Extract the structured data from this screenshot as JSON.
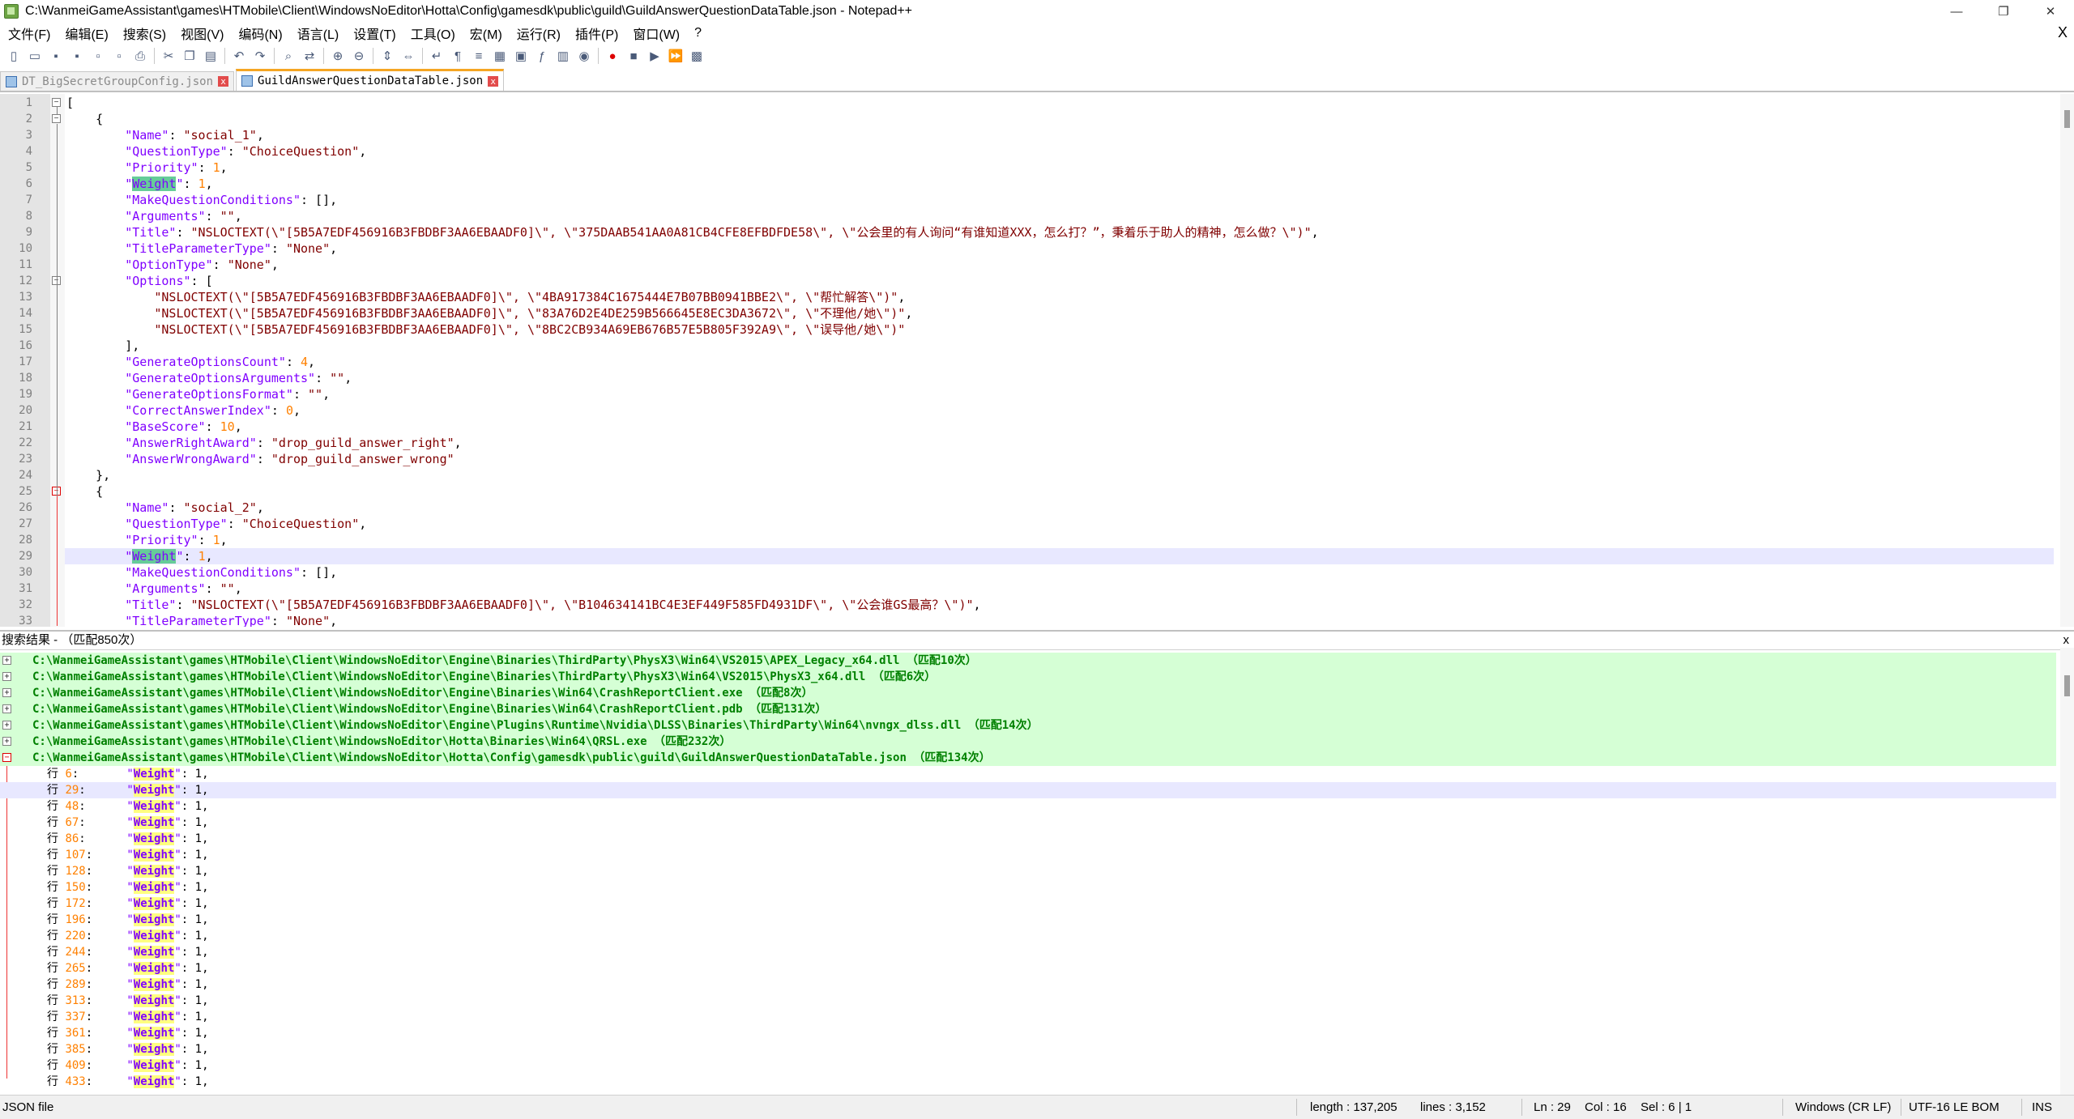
{
  "window": {
    "title": "C:\\WanmeiGameAssistant\\games\\HTMobile\\Client\\WindowsNoEditor\\Hotta\\Config\\gamesdk\\public\\guild\\GuildAnswerQuestionDataTable.json - Notepad++",
    "minimize": "—",
    "restore": "❐",
    "close": "✕"
  },
  "menu": [
    "文件(F)",
    "编辑(E)",
    "搜索(S)",
    "视图(V)",
    "编码(N)",
    "语言(L)",
    "设置(T)",
    "工具(O)",
    "宏(M)",
    "运行(R)",
    "插件(P)",
    "窗口(W)",
    "?"
  ],
  "menu_close": "X",
  "toolbar_icons": [
    "new-file-icon",
    "open-file-icon",
    "save-icon",
    "save-all-icon",
    "close-icon",
    "close-all-icon",
    "print-icon",
    "cut-icon",
    "copy-icon",
    "paste-icon",
    "undo-icon",
    "redo-icon",
    "find-icon",
    "replace-icon",
    "zoom-in-icon",
    "zoom-out-icon",
    "sync-vertical-icon",
    "sync-horizontal-icon",
    "word-wrap-icon",
    "show-all-chars-icon",
    "indent-guide-icon",
    "user-lang-icon",
    "doc-map-icon",
    "function-list-icon",
    "folder-workspace-icon",
    "monitor-icon",
    "record-macro-icon",
    "stop-record-icon",
    "play-macro-icon",
    "run-macro-multiple-icon",
    "save-macro-icon"
  ],
  "tabs": [
    {
      "label": "DT_BigSecretGroupConfig.json",
      "active": false
    },
    {
      "label": "GuildAnswerQuestionDataTable.json",
      "active": true
    }
  ],
  "editor": {
    "lines": [
      {
        "n": "1",
        "text": "["
      },
      {
        "n": "2",
        "text": "    {"
      },
      {
        "n": "3",
        "text": "        \"Name\": \"social_1\","
      },
      {
        "n": "4",
        "text": "        \"QuestionType\": \"ChoiceQuestion\","
      },
      {
        "n": "5",
        "text": "        \"Priority\": 1,"
      },
      {
        "n": "6",
        "text": "        \"Weight\": 1,"
      },
      {
        "n": "7",
        "text": "        \"MakeQuestionConditions\": [],"
      },
      {
        "n": "8",
        "text": "        \"Arguments\": \"\","
      },
      {
        "n": "9",
        "text": "        \"Title\": \"NSLOCTEXT(\\\"[5B5A7EDF456916B3FBDBF3AA6EBAADF0]\\\", \\\"375DAAB541AA0A81CB4CFE8EFBDFDE58\\\", \\\"公会里的有人询问“有谁知道XXX，怎么打？”，秉着乐于助人的精神，怎么做？\\\")\","
      },
      {
        "n": "10",
        "text": "        \"TitleParameterType\": \"None\","
      },
      {
        "n": "11",
        "text": "        \"OptionType\": \"None\","
      },
      {
        "n": "12",
        "text": "        \"Options\": ["
      },
      {
        "n": "13",
        "text": "            \"NSLOCTEXT(\\\"[5B5A7EDF456916B3FBDBF3AA6EBAADF0]\\\", \\\"4BA917384C1675444E7B07BB0941BBE2\\\", \\\"帮忙解答\\\")\","
      },
      {
        "n": "14",
        "text": "            \"NSLOCTEXT(\\\"[5B5A7EDF456916B3FBDBF3AA6EBAADF0]\\\", \\\"83A76D2E4DE259B566645E8EC3DA3672\\\", \\\"不理他/她\\\")\","
      },
      {
        "n": "15",
        "text": "            \"NSLOCTEXT(\\\"[5B5A7EDF456916B3FBDBF3AA6EBAADF0]\\\", \\\"8BC2CB934A69EB676B57E5B805F392A9\\\", \\\"误导他/她\\\")\""
      },
      {
        "n": "16",
        "text": "        ],"
      },
      {
        "n": "17",
        "text": "        \"GenerateOptionsCount\": 4,"
      },
      {
        "n": "18",
        "text": "        \"GenerateOptionsArguments\": \"\","
      },
      {
        "n": "19",
        "text": "        \"GenerateOptionsFormat\": \"\","
      },
      {
        "n": "20",
        "text": "        \"CorrectAnswerIndex\": 0,"
      },
      {
        "n": "21",
        "text": "        \"BaseScore\": 10,"
      },
      {
        "n": "22",
        "text": "        \"AnswerRightAward\": \"drop_guild_answer_right\","
      },
      {
        "n": "23",
        "text": "        \"AnswerWrongAward\": \"drop_guild_answer_wrong\""
      },
      {
        "n": "24",
        "text": "    },"
      },
      {
        "n": "25",
        "text": "    {"
      },
      {
        "n": "26",
        "text": "        \"Name\": \"social_2\","
      },
      {
        "n": "27",
        "text": "        \"QuestionType\": \"ChoiceQuestion\","
      },
      {
        "n": "28",
        "text": "        \"Priority\": 1,"
      },
      {
        "n": "29",
        "text": "        \"Weight\": 1,"
      },
      {
        "n": "30",
        "text": "        \"MakeQuestionConditions\": [],"
      },
      {
        "n": "31",
        "text": "        \"Arguments\": \"\","
      },
      {
        "n": "32",
        "text": "        \"Title\": \"NSLOCTEXT(\\\"[5B5A7EDF456916B3FBDBF3AA6EBAADF0]\\\", \\\"B104634141BC4E3EF449F585FD4931DF\\\", \\\"公会谁GS最高？\\\")\","
      },
      {
        "n": "33",
        "text": "        \"TitleParameterType\": \"None\","
      }
    ],
    "current_line": "29"
  },
  "search": {
    "header": "搜索结果 - （匹配850次）",
    "close": "x",
    "files": [
      {
        "path": "C:\\WanmeiGameAssistant\\games\\HTMobile\\Client\\WindowsNoEditor\\Engine\\Binaries\\ThirdParty\\PhysX3\\Win64\\VS2015\\APEX_Legacy_x64.dll",
        "count": "（匹配10次）",
        "expanded": false
      },
      {
        "path": "C:\\WanmeiGameAssistant\\games\\HTMobile\\Client\\WindowsNoEditor\\Engine\\Binaries\\ThirdParty\\PhysX3\\Win64\\VS2015\\PhysX3_x64.dll",
        "count": "（匹配6次）",
        "expanded": false
      },
      {
        "path": "C:\\WanmeiGameAssistant\\games\\HTMobile\\Client\\WindowsNoEditor\\Engine\\Binaries\\Win64\\CrashReportClient.exe",
        "count": "（匹配8次）",
        "expanded": false
      },
      {
        "path": "C:\\WanmeiGameAssistant\\games\\HTMobile\\Client\\WindowsNoEditor\\Engine\\Binaries\\Win64\\CrashReportClient.pdb",
        "count": "（匹配131次）",
        "expanded": false
      },
      {
        "path": "C:\\WanmeiGameAssistant\\games\\HTMobile\\Client\\WindowsNoEditor\\Engine\\Plugins\\Runtime\\Nvidia\\DLSS\\Binaries\\ThirdParty\\Win64\\nvngx_dlss.dll",
        "count": "（匹配14次）",
        "expanded": false
      },
      {
        "path": "C:\\WanmeiGameAssistant\\games\\HTMobile\\Client\\WindowsNoEditor\\Hotta\\Binaries\\Win64\\QRSL.exe",
        "count": "（匹配232次）",
        "expanded": false
      },
      {
        "path": "C:\\WanmeiGameAssistant\\games\\HTMobile\\Client\\WindowsNoEditor\\Hotta\\Config\\gamesdk\\public\\guild\\GuildAnswerQuestionDataTable.json",
        "count": "（匹配134次）",
        "expanded": true
      }
    ],
    "row_prefix": "行",
    "key": "Weight",
    "value_suffix": ": 1,",
    "results": [
      "6",
      "29",
      "48",
      "67",
      "86",
      "107",
      "128",
      "150",
      "172",
      "196",
      "220",
      "244",
      "265",
      "289",
      "313",
      "337",
      "361",
      "385",
      "409",
      "433"
    ],
    "selected_result": "29"
  },
  "status": {
    "file_type": "JSON file",
    "length": "length : 137,205",
    "lines": "lines : 3,152",
    "ln": "Ln : 29",
    "col": "Col : 16",
    "sel": "Sel : 6 | 1",
    "eol": "Windows (CR LF)",
    "encoding": "UTF-16 LE BOM",
    "mode": "INS"
  },
  "colors": {
    "keyword": "#8000ff",
    "string": "#800000",
    "number": "#ff8000",
    "match_highlight": "#66cc99",
    "search_file_bg": "#d5ffd5",
    "search_file_text": "#008000",
    "current_line": "#e8e8ff"
  }
}
